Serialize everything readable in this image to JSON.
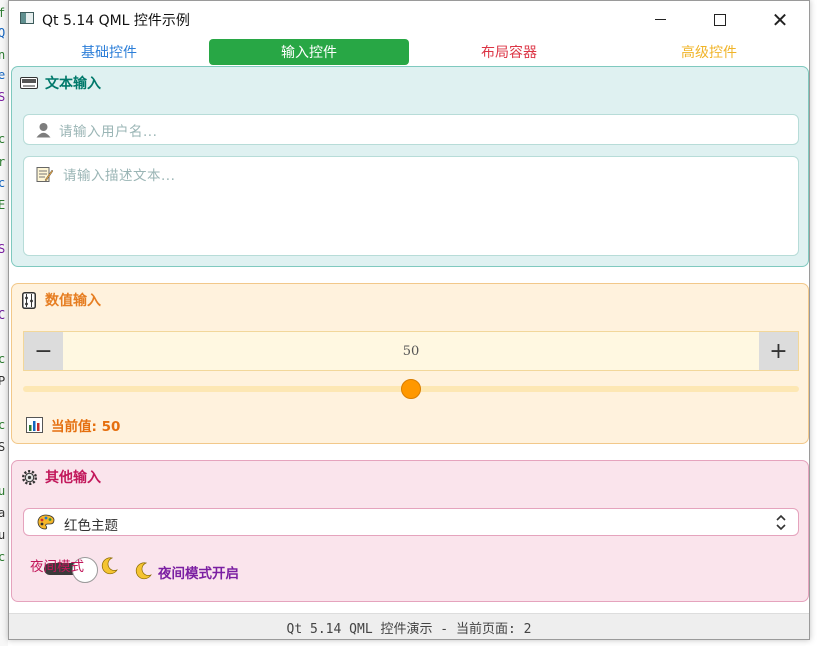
{
  "window": {
    "title": "Qt 5.14 QML 控件示例",
    "controls": {
      "minimize": "minimize-icon",
      "maximize": "maximize-icon",
      "close": "close-icon"
    }
  },
  "tabs": [
    {
      "label": "基础控件",
      "color": "#2b7ed8",
      "active": false
    },
    {
      "label": "输入控件",
      "color": "#ffffff",
      "active": true
    },
    {
      "label": "布局容器",
      "color": "#dc3545",
      "active": false
    },
    {
      "label": "高级控件",
      "color": "#f0b429",
      "active": false
    }
  ],
  "text_input_group": {
    "title": "文本输入",
    "icon": "keyboard-icon",
    "color": "#00796b",
    "username_placeholder": "请输入用户名...",
    "username_value": "",
    "description_placeholder": "请输入描述文本...",
    "description_value": ""
  },
  "numeric_group": {
    "title": "数值输入",
    "icon": "abacus-icon",
    "color": "#e67e22",
    "spin_value": "50",
    "spin_minus": "−",
    "spin_plus": "+",
    "slider_value": 0.5,
    "current_value_text": "当前值: 50"
  },
  "other_group": {
    "title": "其他输入",
    "icon": "gear-icon",
    "color": "#c2185b",
    "theme_selected": "红色主题",
    "night_mode_label": "夜间模式",
    "night_mode_on": true,
    "night_mode_status": "夜间模式开启",
    "status_color": "#7b1fa2"
  },
  "footer": {
    "text": "Qt 5.14 QML 控件演示 - 当前页面: 2"
  },
  "accent": {
    "active_tab": "#28a745",
    "slider": "#ff9800"
  }
}
